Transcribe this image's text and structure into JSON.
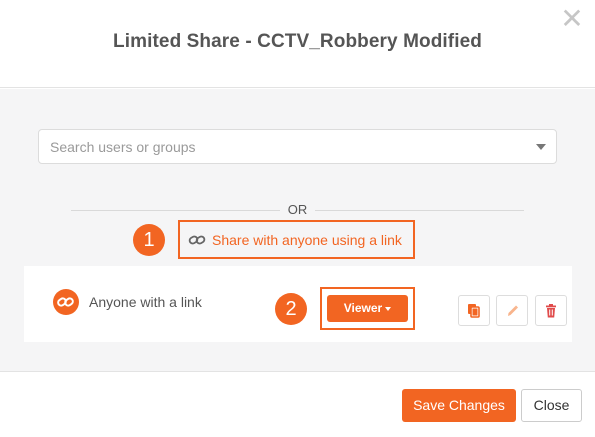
{
  "dialog": {
    "title": "Limited Share - CCTV_Robbery Modified",
    "close_glyph": "✕"
  },
  "search": {
    "placeholder": "Search users or groups",
    "value": ""
  },
  "separator": {
    "label": "OR"
  },
  "share_link": {
    "label": "Share with anyone using a link",
    "icon": "link-icon"
  },
  "annotations": {
    "step1": "1",
    "step2": "2"
  },
  "share_row": {
    "label": "Anyone with a link",
    "icon": "link-icon",
    "role": "Viewer",
    "actions": [
      "copy-icon",
      "pencil-icon",
      "trash-icon"
    ]
  },
  "footer": {
    "save_label": "Save Changes",
    "close_label": "Close"
  },
  "colors": {
    "accent": "#f26522",
    "panel_bg": "#f5f5f6",
    "title_text": "#555555"
  }
}
